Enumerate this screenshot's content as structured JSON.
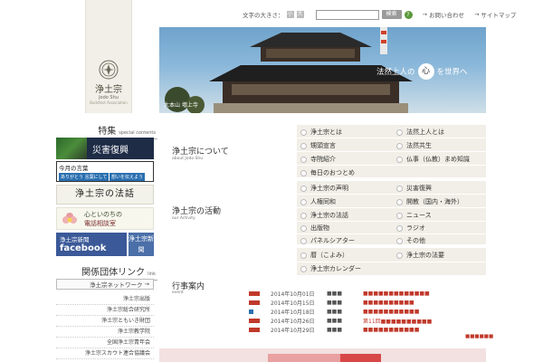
{
  "logo": {
    "name": "浄土宗",
    "en": "Jodo Shu",
    "sub": "Buddhist Association"
  },
  "topbar": {
    "font_size_label": "文字の大きさ：",
    "font_small": "小",
    "font_large": "大",
    "search_button": "検索",
    "help": "?",
    "contact": "お問い合わせ",
    "sitemap": "サイトマップ"
  },
  "hero": {
    "slogan_before": "法然上人の",
    "slogan_heart": "心",
    "slogan_after": "を世界へ",
    "caption": "大本山 増上寺"
  },
  "sidebar": {
    "special": {
      "jp": "特集",
      "en": "special contents"
    },
    "banner_disaster": "災害復興",
    "banner_words": {
      "title": "今月の言葉",
      "p1": "ありがとう 言葉にして",
      "p2": "想いを伝えよう"
    },
    "banner_dharma": "浄土宗の法話",
    "banner_phone": {
      "l1": "心といのちの",
      "l2": "電話相談室"
    },
    "banner_fb": {
      "a": "浄土宗新聞",
      "b": "facebook",
      "np": "浄土宗新聞"
    },
    "groups": {
      "jp": "関係団体リンク",
      "en": "link"
    },
    "network_button": "浄土宗ネットワーク",
    "group_items": [
      "浄土宗出版",
      "浄土宗総合研究所",
      "浄土宗ともいき財団",
      "浄土宗教学院",
      "全国浄土宗青年会",
      "浄土宗スカウト連合協議会"
    ]
  },
  "sections": [
    {
      "jp": "浄土宗について",
      "en": "about Jodo Shu",
      "links": [
        "浄土宗とは",
        "法然上人とは",
        "甥頭宣言",
        "法然共生",
        "寺院紹介",
        "仏事（仏教）まめ知識",
        "毎日のおつとめ"
      ]
    },
    {
      "jp": "浄土宗の活動",
      "en": "our Activity",
      "links": [
        "浄土宗の声明",
        "災害復興",
        "人権同和",
        "開教（国内・海外）",
        "浄土宗の法話",
        "ニュース",
        "出版物",
        "ラジオ",
        "パネルシアター",
        "その他"
      ]
    },
    {
      "links": [
        "暦（こよみ）",
        "浄土宗の法要",
        "浄土宗カレンダー"
      ]
    }
  ],
  "events": {
    "jp": "行事案内",
    "en": "event",
    "rows": [
      {
        "date": "2014年10月01日",
        "place": "■■■",
        "color": "#c0392b",
        "title": "■■■■■■■■■■■■■"
      },
      {
        "date": "2014年10月15日",
        "place": "■■■",
        "color": "#c0392b",
        "title": "■■■■■■■■■■"
      },
      {
        "date": "2014年10月18日",
        "place": "■■■",
        "color": "#2a6fb0",
        "title": "■■■■■■■■■■■"
      },
      {
        "date": "2014年10月26日",
        "place": "■■■",
        "color": "#c0392b",
        "title": "第11回■■■■■■■■■■"
      },
      {
        "date": "2014年10月29日",
        "place": "■■■",
        "color": "#c0392b",
        "title": "■■■■■■■■■■■"
      }
    ],
    "more": "■■■■■■"
  }
}
